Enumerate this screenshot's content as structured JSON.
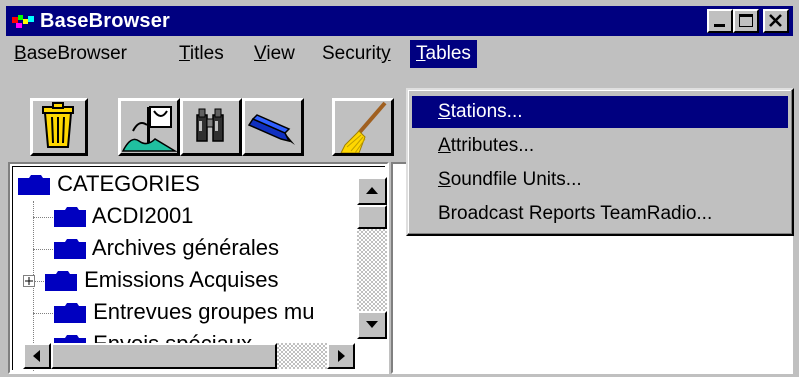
{
  "window": {
    "title": "BaseBrowser",
    "controls": [
      "minimize",
      "maximize",
      "close"
    ]
  },
  "menubar": {
    "items": [
      {
        "label": "BaseBrowser",
        "accel": "B",
        "rest": "aseBrowser"
      },
      {
        "label": "Titles",
        "accel": "T",
        "rest": "itles"
      },
      {
        "label": "View",
        "accel": "V",
        "rest": "iew"
      },
      {
        "label": "Security",
        "pre": "Securit",
        "accel": "y",
        "rest": ""
      },
      {
        "label": "Tables",
        "accel": "T",
        "rest": "ables"
      }
    ],
    "active": "Tables"
  },
  "toolbar": {
    "buttons": [
      "trash-can-icon",
      "flag-landscape-icon",
      "binoculars-icon",
      "pen-icon",
      "broom-icon"
    ]
  },
  "tree": {
    "root": "CATEGORIES",
    "items": [
      "ACDI2001",
      "Archives générales",
      "Emissions Acquises",
      "Entrevues groupes mu",
      "Envois spéciaux"
    ]
  },
  "tables_menu": {
    "items": [
      {
        "label": "Stations...",
        "accel": "S",
        "rest": "tations...",
        "selected": true
      },
      {
        "label": "Attributes...",
        "accel": "A",
        "rest": "ttributes...",
        "selected": false
      },
      {
        "label": "Soundfile Units...",
        "accel": "S",
        "rest": "oundfile Units...",
        "selected": false
      },
      {
        "label": "Broadcast Reports TeamRadio...",
        "accel": "",
        "rest": "Broadcast Reports TeamRadio...",
        "selected": false
      }
    ]
  },
  "colors": {
    "titlebar": "#000080",
    "face": "#c0c0c0",
    "folder": "#0000c0",
    "highlight": "#000080"
  }
}
